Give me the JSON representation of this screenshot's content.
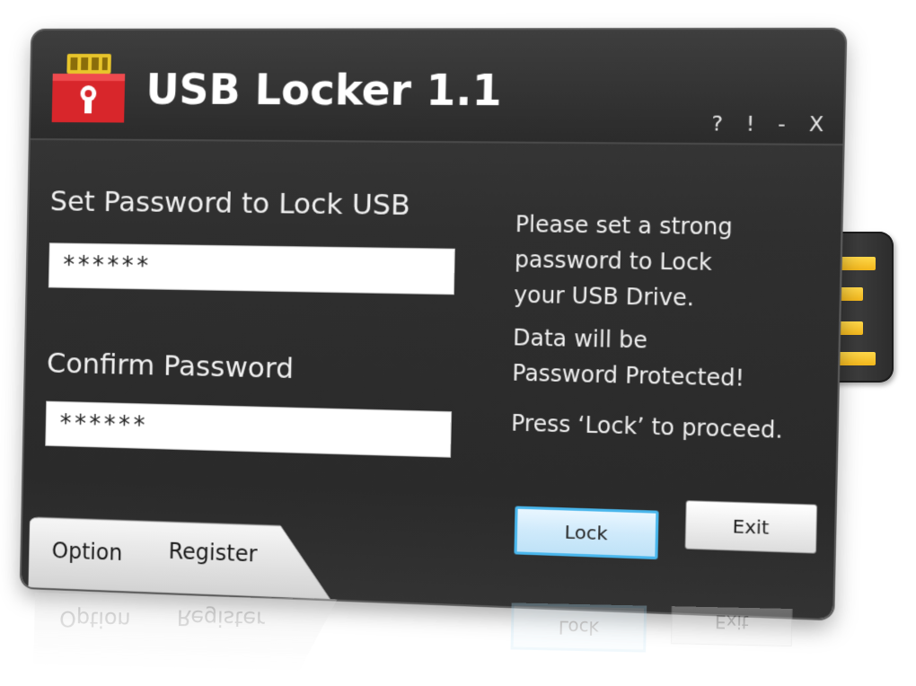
{
  "app": {
    "title": "USB Locker 1.1",
    "logo_icon": "usb-lock-icon",
    "title_controls": {
      "help": "?",
      "info": "!",
      "minimize": "-",
      "close": "X"
    }
  },
  "form": {
    "set_password_label": "Set Password to Lock USB",
    "set_password_value": "******",
    "confirm_password_label": "Confirm Password",
    "confirm_password_value": "******"
  },
  "info": {
    "line1": "Please set a strong",
    "line2": "password to Lock",
    "line3": "your USB Drive.",
    "line4": "Data will be",
    "line5": "Password Protected!",
    "line6": "Press ‘Lock’ to proceed."
  },
  "buttons": {
    "lock_label": "Lock",
    "exit_label": "Exit"
  },
  "bottom_tabs": {
    "option_label": "Option",
    "register_label": "Register"
  },
  "colors": {
    "window_bg": "#2f2f2f",
    "text": "#f0f0f0",
    "lock_button_border": "#49b6ec",
    "usb_pins": "#f2b61b",
    "logo_red": "#d8262b"
  }
}
